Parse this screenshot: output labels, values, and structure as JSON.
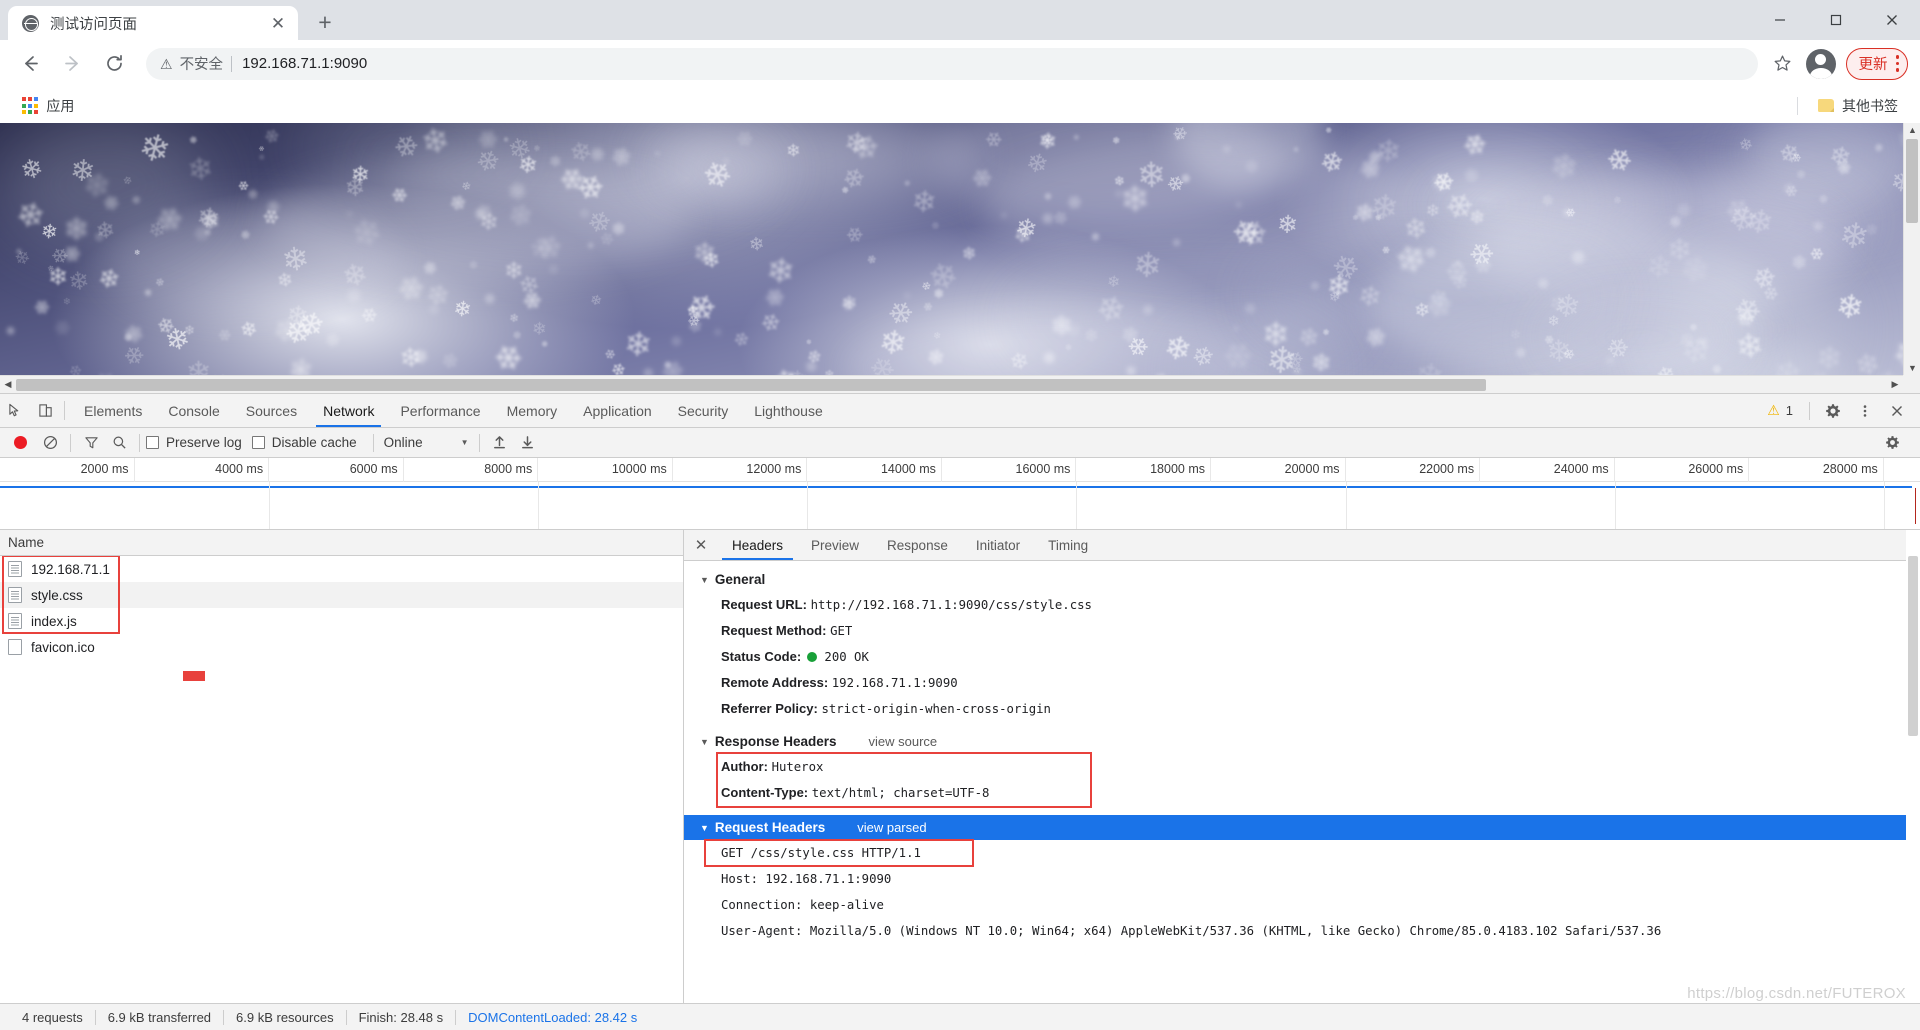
{
  "browser": {
    "tab": {
      "title": "测试访问页面",
      "favicon": "globe-icon",
      "close": "✕"
    },
    "newtab_label": "+",
    "window_controls": {
      "minimize": "minimize-icon",
      "maximize": "maximize-icon",
      "close": "close-icon"
    },
    "nav": {
      "back": "←",
      "forward": "→",
      "reload": "⟳"
    },
    "omnibox": {
      "warning_glyph": "⚠",
      "security_label": "不安全",
      "url": "192.168.71.1:9090"
    },
    "star_icon": "☆",
    "profile_icon": "account-avatar",
    "update_button": {
      "label": "更新",
      "color": "#d93025"
    },
    "menu_icon": "three-dot-menu",
    "bookmarks": {
      "apps_label": "应用",
      "other_label": "其他书签"
    }
  },
  "devtools": {
    "tabs": [
      {
        "label": "Elements",
        "active": false
      },
      {
        "label": "Console",
        "active": false
      },
      {
        "label": "Sources",
        "active": false
      },
      {
        "label": "Network",
        "active": true
      },
      {
        "label": "Performance",
        "active": false
      },
      {
        "label": "Memory",
        "active": false
      },
      {
        "label": "Application",
        "active": false
      },
      {
        "label": "Security",
        "active": false
      },
      {
        "label": "Lighthouse",
        "active": false
      }
    ],
    "warning_count": "1",
    "icons": {
      "inspect": "inspect-element-icon",
      "device": "device-toolbar-icon",
      "settings": "gear-icon",
      "more": "three-dot-menu",
      "close": "close-icon",
      "warning": "warning-triangle-icon"
    },
    "network_toolbar": {
      "record_label": "record-button",
      "clear_label": "clear-button",
      "filter_label": "filter-icon",
      "search_label": "search-icon",
      "preserve_log": "Preserve log",
      "disable_cache": "Disable cache",
      "throttle_value": "Online",
      "caret": "▼",
      "import_label": "import-har-icon",
      "export_label": "export-har-icon",
      "settings_label": "network-settings-icon"
    },
    "timeline": {
      "ticks": [
        "2000 ms",
        "4000 ms",
        "6000 ms",
        "8000 ms",
        "10000 ms",
        "12000 ms",
        "14000 ms",
        "16000 ms",
        "18000 ms",
        "20000 ms",
        "22000 ms",
        "24000 ms",
        "26000 ms",
        "28000 ms"
      ]
    },
    "request_list": {
      "column_name": "Name",
      "rows": [
        {
          "name": "192.168.71.1",
          "icon": "document-icon"
        },
        {
          "name": "style.css",
          "icon": "document-icon"
        },
        {
          "name": "index.js",
          "icon": "document-icon"
        },
        {
          "name": "favicon.ico",
          "icon": "blank-document-icon"
        }
      ]
    },
    "detail": {
      "close": "✕",
      "tabs": [
        {
          "label": "Headers",
          "active": true
        },
        {
          "label": "Preview",
          "active": false
        },
        {
          "label": "Response",
          "active": false
        },
        {
          "label": "Initiator",
          "active": false
        },
        {
          "label": "Timing",
          "active": false
        }
      ],
      "general": {
        "title": "General",
        "rows": [
          {
            "key": "Request URL:",
            "value": "http://192.168.71.1:9090/css/style.css"
          },
          {
            "key": "Request Method:",
            "value": "GET"
          },
          {
            "key": "Status Code:",
            "value": "200 OK",
            "has_status_dot": true
          },
          {
            "key": "Remote Address:",
            "value": "192.168.71.1:9090"
          },
          {
            "key": "Referrer Policy:",
            "value": "strict-origin-when-cross-origin"
          }
        ]
      },
      "response_headers": {
        "title": "Response Headers",
        "link": "view source",
        "rows": [
          {
            "key": "Author:",
            "value": "Huterox"
          },
          {
            "key": "Content-Type:",
            "value": "text/html; charset=UTF-8"
          }
        ]
      },
      "request_headers": {
        "title": "Request Headers",
        "link": "view parsed",
        "selected": true,
        "rows": [
          {
            "raw": "GET /css/style.css HTTP/1.1"
          },
          {
            "raw": "Host: 192.168.71.1:9090"
          },
          {
            "raw": "Connection: keep-alive"
          },
          {
            "raw": "User-Agent: Mozilla/5.0 (Windows NT 10.0; Win64; x64) AppleWebKit/537.36 (KHTML, like Gecko) Chrome/85.0.4183.102 Safari/537.36"
          }
        ]
      }
    },
    "status_bar": {
      "requests": "4 requests",
      "transferred": "6.9 kB transferred",
      "resources": "6.9 kB resources",
      "finish": "Finish: 28.48 s",
      "dom_content_loaded": "DOMContentLoaded: 28.42 s"
    }
  },
  "watermark": "https://blog.csdn.net/FUTEROX"
}
